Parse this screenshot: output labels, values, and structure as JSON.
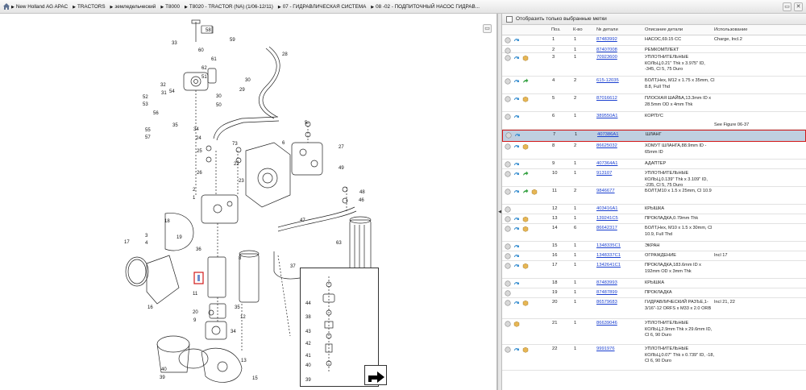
{
  "breadcrumb": [
    "New Holland AG APAC",
    "TRACTORS",
    "земледельческий",
    "T8000",
    "T8020 - TRACTOR (NA) (1/06-12/11)",
    "07 - ГИДРАВЛИЧЕСКАЯ СИСТЕМА",
    "08 -02 - ПОДПИТОЧНЫЙ НАСОС ГИДРАВ..."
  ],
  "diagram": {
    "tab_label": "58",
    "callouts": [
      "33",
      "58",
      "59",
      "60",
      "61",
      "62",
      "30",
      "29",
      "28",
      "32",
      "31",
      "34",
      "54",
      "52",
      "53",
      "56",
      "55",
      "57",
      "35",
      "30",
      "50",
      "51",
      "73",
      "22",
      "23",
      "24",
      "25",
      "26",
      "6",
      "5",
      "27",
      "49",
      "48",
      "46",
      "47",
      "63",
      "2",
      "1",
      "4",
      "3",
      "18",
      "19",
      "36",
      "17",
      "16",
      "37",
      "20",
      "9",
      "11",
      "8",
      "35",
      "34",
      "10",
      "44",
      "38",
      "39",
      "43",
      "42",
      "41",
      "40",
      "39",
      "15",
      "13",
      "12",
      "14",
      "7"
    ],
    "highlight_callout": "35",
    "inset_callouts": [
      "44",
      "38",
      "43",
      "42",
      "41",
      "40",
      "39"
    ]
  },
  "filter": {
    "label": "Отобразить только выбранные метки",
    "checked": false
  },
  "table": {
    "headers": {
      "pos": "Поз.",
      "qty": "К-во",
      "num": "№ детали",
      "desc": "Описание детали",
      "use": "Использование"
    },
    "rows": [
      {
        "pos": "1",
        "qty": "1",
        "num": "87483992",
        "desc": "НАСОС,69.15 CC",
        "use": "Charge, Incl.2",
        "icons": [
          "circle",
          "arrow"
        ]
      },
      {
        "pos": "2",
        "qty": "1",
        "num": "87407008",
        "desc": "РЕМКОМПЛЕКТ",
        "use": "",
        "icons": [
          "circle"
        ]
      },
      {
        "pos": "3",
        "qty": "1",
        "num": "70923600",
        "desc": "УПЛОТНИТЕЛЬНЫЕ КОЛЬЦ,0.21\" Thk x 3.975\" ID, -345, Cl 5, 75 Duro",
        "use": "",
        "icons": [
          "circle",
          "arrow",
          "box"
        ]
      },
      {
        "pos": "4",
        "qty": "2",
        "num": "615-12035",
        "desc": "БОЛТ,Hex, M12 x 1.75 x 35mm, Cl 8.8, Full Thd",
        "use": "",
        "icons": [
          "circle",
          "arrow",
          "green"
        ]
      },
      {
        "pos": "5",
        "qty": "2",
        "num": "87016612",
        "desc": "ПЛОСКАЯ ШАЙБА,13.3mm ID x 28.5mm OD x 4mm Thk",
        "use": "",
        "icons": [
          "circle",
          "arrow",
          "box"
        ]
      },
      {
        "pos": "6",
        "qty": "1",
        "num": "389550A1",
        "desc": "КОРПУС",
        "use": "",
        "icons": [
          "circle",
          "arrow"
        ],
        "note": "See Figure 06-37"
      },
      {
        "pos": "7",
        "qty": "1",
        "num": "407386A1",
        "desc": "ШЛАНГ",
        "use": "",
        "icons": [
          "circle",
          "arrow"
        ]
      },
      {
        "pos": "8",
        "qty": "2",
        "num": "86625032",
        "desc": "ХОМУТ ШЛАНГА,88.9mm ID - 65mm ID",
        "use": "",
        "icons": [
          "circle",
          "arrow",
          "box"
        ]
      },
      {
        "pos": "9",
        "qty": "1",
        "num": "407364A1",
        "desc": "АДАПТЕР",
        "use": "",
        "icons": [
          "circle",
          "arrow"
        ]
      },
      {
        "pos": "10",
        "qty": "1",
        "num": "913107",
        "desc": "УПЛОТНИТЕЛЬНЫЕ КОЛЬЦ,0.139\" Thk x 3.109\" ID, -235, Cl 5, 75 Duro",
        "use": "",
        "icons": [
          "circle",
          "arrow",
          "green"
        ]
      },
      {
        "pos": "11",
        "qty": "2",
        "num": "9846677",
        "desc": "БОЛТ,M10 x 1.5 x 25mm, Cl 10.9",
        "use": "",
        "icons": [
          "circle",
          "arrow",
          "green",
          "box"
        ]
      },
      {
        "pos": "12",
        "qty": "1",
        "num": "403416A1",
        "desc": "КРЫШКА",
        "use": "",
        "icons": [
          "circle"
        ]
      },
      {
        "pos": "13",
        "qty": "1",
        "num": "139241C5",
        "desc": "ПРОКЛАДКА,0.79mm Thk",
        "use": "",
        "icons": [
          "circle",
          "arrow",
          "box"
        ]
      },
      {
        "pos": "14",
        "qty": "6",
        "num": "86642317",
        "desc": "БОЛТ,Hex, M10 x 1.5 x 30mm, Cl 10.9, Full Thd",
        "use": "",
        "icons": [
          "circle",
          "arrow",
          "box"
        ]
      },
      {
        "pos": "15",
        "qty": "1",
        "num": "1348335C1",
        "desc": "ЭКРАН",
        "use": "",
        "icons": [
          "circle",
          "arrow"
        ]
      },
      {
        "pos": "16",
        "qty": "1",
        "num": "1348337C1",
        "desc": "ОГРАЖДЕНИЕ",
        "use": "Incl 17",
        "icons": [
          "circle",
          "arrow"
        ]
      },
      {
        "pos": "17",
        "qty": "1",
        "num": "1342641C1",
        "desc": "ПРОКЛАДКА,183.6mm ID x 192mm OD x 3mm Thk",
        "use": "",
        "icons": [
          "circle",
          "arrow",
          "box"
        ]
      },
      {
        "pos": "18",
        "qty": "1",
        "num": "87483993",
        "desc": "КРЫШКА",
        "use": "",
        "icons": [
          "circle",
          "arrow"
        ]
      },
      {
        "pos": "19",
        "qty": "1",
        "num": "87487899",
        "desc": "ПРОКЛАДКА",
        "use": "",
        "icons": [
          "circle"
        ]
      },
      {
        "pos": "20",
        "qty": "1",
        "num": "86579683",
        "desc": "ГИДРАВЛИЧЕСКИЙ РАЗЪЕ,1-3/16\"-12 ORFS x M33 x 2.0 ORB",
        "use": "Incl 21, 22",
        "icons": [
          "circle",
          "arrow",
          "box"
        ]
      },
      {
        "pos": "21",
        "qty": "1",
        "num": "86639046",
        "desc": "УПЛОТНИТЕЛЬНЫЕ КОЛЬЦ,2.9mm Thk x 29.6mm ID, Cl 6, 90 Duro",
        "use": "",
        "icons": [
          "circle",
          "box"
        ]
      },
      {
        "pos": "22",
        "qty": "1",
        "num": "9991976",
        "desc": "УПЛОТНИТЕЛЬНЫЕ КОЛЬЦ,0.07\" Thk x 0.739\" ID, -18, Cl 6, 90 Duro",
        "use": "",
        "icons": [
          "circle",
          "arrow",
          "box"
        ]
      }
    ],
    "selected_pos": "7"
  }
}
